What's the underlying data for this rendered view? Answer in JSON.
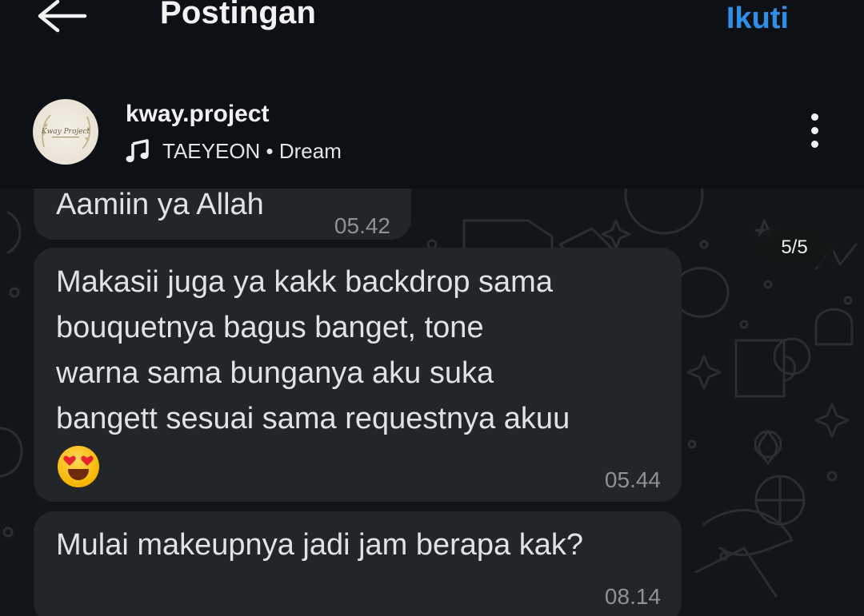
{
  "appbar": {
    "title": "Postingan",
    "follow_label": "Ikuti",
    "back_icon": "arrow-left-icon"
  },
  "post": {
    "username": "kway.project",
    "music": "TAEYEON • Dream",
    "music_icon": "music-note-icon",
    "avatar_text": "Kway Project",
    "more_icon": "more-vertical-icon"
  },
  "chat": {
    "page_counter": "5/5",
    "messages": [
      {
        "text": "Aamiin ya Allah",
        "time": "05.42"
      },
      {
        "text": "Makasii juga ya kakk backdrop sama\nbouquetnya bagus banget, tone\nwarna sama bunganya aku suka\nbangett sesuai sama requestnya akuu",
        "emoji": "heart-eyes-emoji",
        "time": "05.44"
      },
      {
        "text": "Mulai makeupnya jadi jam berapa kak?",
        "time": "08.14"
      }
    ]
  },
  "colors": {
    "accent": "#2f8fe8",
    "background": "#101418",
    "bubble": "#232628"
  }
}
